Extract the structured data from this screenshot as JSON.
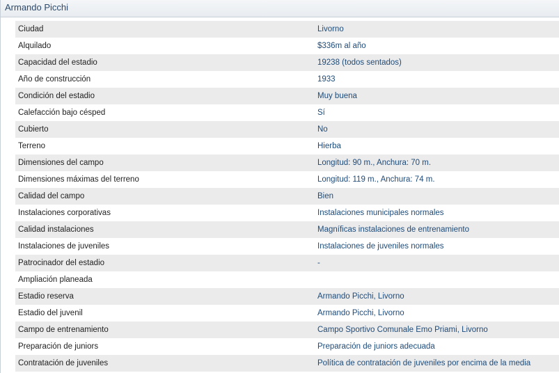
{
  "title": "Armando Picchi",
  "rows": [
    {
      "label": "Ciudad",
      "value": "Livorno"
    },
    {
      "label": "Alquilado",
      "value": "$336m al año"
    },
    {
      "label": "Capacidad del estadio",
      "value": "19238 (todos sentados)"
    },
    {
      "label": "Año de construcción",
      "value": "1933"
    },
    {
      "label": "Condición del estadio",
      "value": "Muy buena"
    },
    {
      "label": "Calefacción bajo césped",
      "value": "Sí"
    },
    {
      "label": "Cubierto",
      "value": "No"
    },
    {
      "label": "Terreno",
      "value": "Hierba"
    },
    {
      "label": "Dimensiones del campo",
      "value": "Longitud: 90 m., Anchura: 70 m."
    },
    {
      "label": "Dimensiones máximas del terreno",
      "value": "Longitud: 119 m., Anchura: 74 m."
    },
    {
      "label": "Calidad del campo",
      "value": "Bien"
    },
    {
      "label": "Instalaciones corporativas",
      "value": "Instalaciones municipales normales"
    },
    {
      "label": "Calidad instalaciones",
      "value": "Magníficas instalaciones de entrenamiento"
    },
    {
      "label": "Instalaciones de juveniles",
      "value": "Instalaciones de juveniles normales"
    },
    {
      "label": "Patrocinador del estadio",
      "value": "-"
    },
    {
      "label": "Ampliación planeada",
      "value": ""
    },
    {
      "label": "Estadio reserva",
      "value": "Armando Picchi, Livorno"
    },
    {
      "label": "Estadio del juvenil",
      "value": "Armando Picchi, Livorno"
    },
    {
      "label": "Campo de entrenamiento",
      "value": "Campo Sportivo Comunale Emo Priami, Livorno"
    },
    {
      "label": "Preparación de juniors",
      "value": "Preparación de juniors adecuada"
    },
    {
      "label": "Contratación de juveniles",
      "value": "Política de contratación de juveniles por encima de la media"
    }
  ]
}
